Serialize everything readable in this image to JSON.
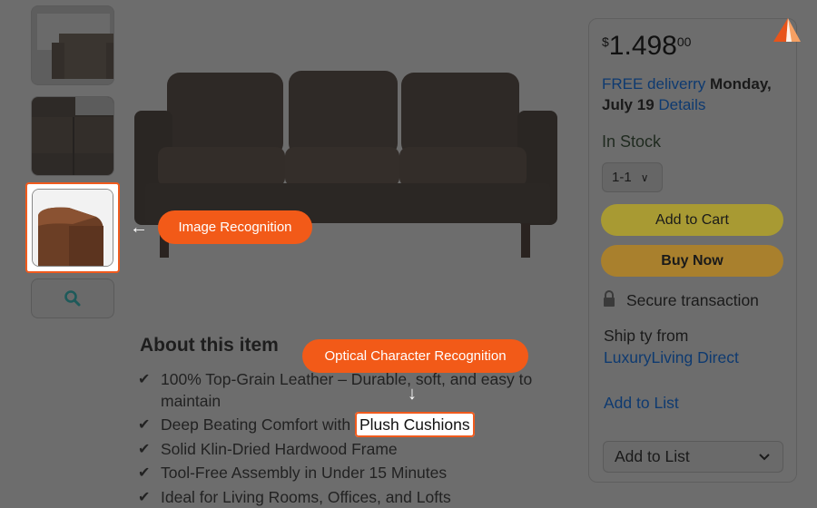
{
  "price": {
    "currency": "$",
    "amount": "1.498",
    "cents": "00"
  },
  "delivery": {
    "free_text": "FREE deliverry",
    "date": "Monday, July 19",
    "details": "Details"
  },
  "stock": "In Stock",
  "quantity": {
    "value": "1-1"
  },
  "buttons": {
    "add_to_cart": "Add to Cart",
    "buy_now": "Buy Now",
    "add_to_list_button": "Add to List"
  },
  "secure_transaction": "Secure transaction",
  "ship_from": {
    "label": "Ship ty from",
    "seller": "LuxuryLiving Direct"
  },
  "add_to_list_link": "Add to List",
  "callouts": {
    "image_recognition": "Image Recognition",
    "ocr": "Optical Character Recognition"
  },
  "about": {
    "title": "About this item",
    "bullets": [
      "100% Top-Grain Leather – Durable, soft, and easy to maintain",
      "Deep Beating Comfort with ",
      "Solid Klin-Dried Hardwood Frame",
      "Tool-Free Assembly in Under 15 Minutes",
      "Ideal for Living Rooms, Offices, and Lofts"
    ],
    "highlighted_text": "Plush Cushions"
  },
  "icons": {
    "search": "search-icon",
    "lock": "lock-icon",
    "check": "check-icon",
    "arrow_left": "arrow-left-icon",
    "arrow_down": "arrow-down-icon",
    "logo": "logo-icon"
  },
  "colors": {
    "accent": "#f25a18",
    "cart_button": "#a89a33",
    "buy_button": "#a9802d",
    "link": "#0e3a70"
  }
}
